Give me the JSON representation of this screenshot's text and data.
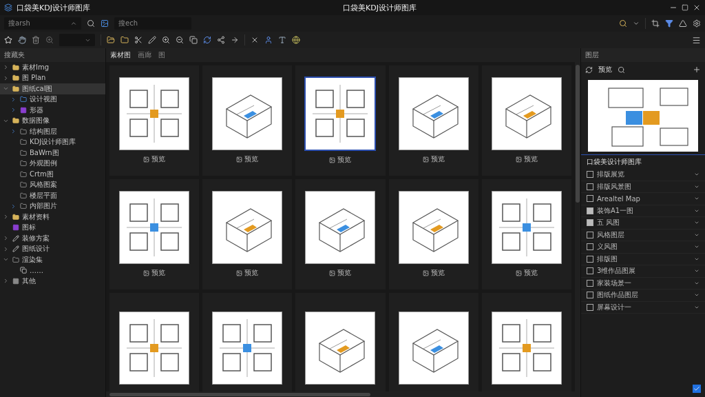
{
  "window": {
    "title": "口袋美KDJ设计师图库",
    "center_title": "口袋美KDJ设计师图库"
  },
  "search": {
    "left_value": "搜arsh",
    "right_value": "搜ech"
  },
  "sidebar": {
    "title": "搜藏夹",
    "items": [
      {
        "label": "素材Img",
        "kind": "folder",
        "expanded": false,
        "selected": false
      },
      {
        "label": "图 Plan",
        "kind": "folder",
        "expanded": false,
        "selected": false
      },
      {
        "label": "图纸cal图",
        "kind": "folder",
        "expanded": true,
        "selected": true,
        "children": [
          {
            "label": "设计视图",
            "kind": "bluefolder",
            "expanded": false,
            "selected": false
          },
          {
            "label": "形器",
            "kind": "tag",
            "expanded": false,
            "selected": false
          }
        ]
      },
      {
        "label": "数据图像",
        "kind": "folder",
        "expanded": true,
        "selected": false,
        "children": [
          {
            "label": "结构图层",
            "kind": "outline",
            "expanded": false,
            "selected": false
          },
          {
            "label": "KDJ设计师图库",
            "kind": "outline",
            "selected": false
          },
          {
            "label": "BaWrn图",
            "kind": "outline",
            "selected": false
          },
          {
            "label": "外观图例",
            "kind": "outline",
            "selected": false
          },
          {
            "label": "Crtm图",
            "kind": "outline",
            "selected": false
          },
          {
            "label": "风格图案",
            "kind": "outline",
            "selected": false
          },
          {
            "label": "楼层平面",
            "kind": "outline",
            "selected": false
          },
          {
            "label": "内部图片",
            "kind": "outline",
            "expanded": false,
            "selected": false
          }
        ]
      },
      {
        "label": "素材资料",
        "kind": "folder",
        "expanded": false,
        "selected": false
      },
      {
        "label": "图标",
        "kind": "tag",
        "selected": false
      },
      {
        "label": "装修方案",
        "kind": "curve",
        "expanded": false,
        "selected": false
      },
      {
        "label": "图纸设计",
        "kind": "curve",
        "expanded": false,
        "selected": false
      },
      {
        "label": "渲染集",
        "kind": "outline",
        "expanded": true,
        "selected": false,
        "children": [
          {
            "label": "……",
            "kind": "stack",
            "selected": false
          }
        ]
      },
      {
        "label": "其他",
        "kind": "block",
        "expanded": false,
        "selected": false
      }
    ]
  },
  "gallery": {
    "tab": "素材图",
    "tabs_extra": [
      "画廊",
      "图"
    ],
    "cards": [
      {
        "label": "预览",
        "kind": "plan",
        "selected": false
      },
      {
        "label": "预览",
        "kind": "iso",
        "selected": false
      },
      {
        "label": "预览",
        "kind": "plan",
        "selected": true
      },
      {
        "label": "预览",
        "kind": "iso",
        "selected": false
      },
      {
        "label": "预览",
        "kind": "iso",
        "selected": false
      },
      {
        "label": "预览",
        "kind": "plan",
        "selected": false
      },
      {
        "label": "预览",
        "kind": "iso",
        "selected": false
      },
      {
        "label": "预览",
        "kind": "iso",
        "selected": false
      },
      {
        "label": "预览",
        "kind": "iso",
        "selected": false
      },
      {
        "label": "预览",
        "kind": "plan",
        "selected": false
      },
      {
        "kind": "plan",
        "selected": false
      },
      {
        "kind": "plan",
        "selected": false
      },
      {
        "kind": "iso",
        "selected": false
      },
      {
        "kind": "iso",
        "selected": false
      },
      {
        "kind": "plan",
        "selected": false
      }
    ]
  },
  "layers": {
    "title": "图层",
    "tab": "预览",
    "list_title": "口袋美设计师图库",
    "items": [
      {
        "label": "排版展览",
        "checked": false
      },
      {
        "label": "排版风景图",
        "checked": false
      },
      {
        "label": "Arealtel Map",
        "checked": false
      },
      {
        "label": "装饰A1一图",
        "checked": true
      },
      {
        "label": "五 风图",
        "checked": true
      },
      {
        "label": "风格图层",
        "checked": false
      },
      {
        "label": "义风图",
        "checked": false
      },
      {
        "label": "排版图",
        "checked": false
      },
      {
        "label": "3维作品图展",
        "checked": false
      },
      {
        "label": "家装场景一",
        "checked": false
      },
      {
        "label": "图纸作品图层",
        "checked": false
      },
      {
        "label": "屏幕设计一",
        "checked": false
      }
    ]
  }
}
